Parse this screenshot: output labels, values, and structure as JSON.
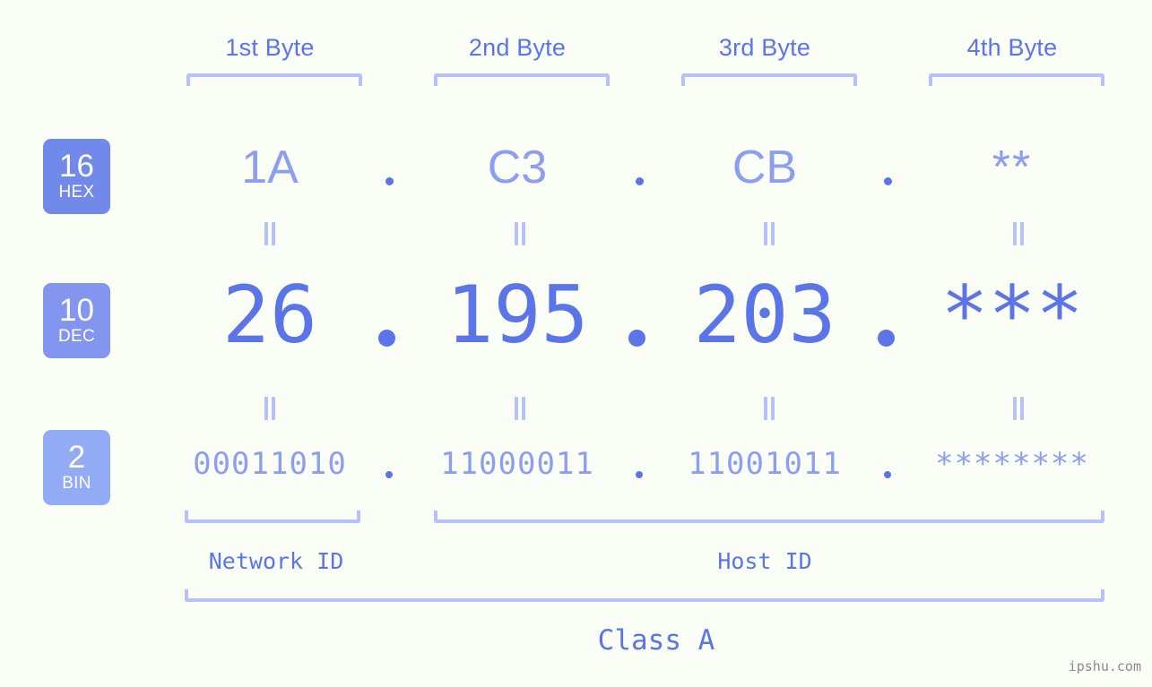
{
  "meta": {
    "background_color": "#fbfdf7",
    "accent_strong": "#5b74e8",
    "accent_light": "#8d9df4",
    "accent_bracket": "#b6c0fb",
    "watermark": "ipshu.com"
  },
  "byte_headers": [
    {
      "label": "1st Byte"
    },
    {
      "label": "2nd Byte"
    },
    {
      "label": "3rd Byte"
    },
    {
      "label": "4th Byte"
    }
  ],
  "bases": [
    {
      "num": "16",
      "name": "HEX",
      "color": "#7289ec"
    },
    {
      "num": "10",
      "name": "DEC",
      "color": "#8495f0"
    },
    {
      "num": "2",
      "name": "BIN",
      "color": "#93aaf5"
    }
  ],
  "rows": {
    "hex": {
      "values": [
        "1A",
        "C3",
        "CB",
        "**"
      ],
      "separator": "."
    },
    "dec": {
      "values": [
        "26",
        "195",
        "203",
        "***"
      ],
      "separator": "."
    },
    "bin": {
      "values": [
        "00011010",
        "11000011",
        "11001011",
        "********"
      ],
      "separator": "."
    }
  },
  "segments": {
    "network_id": "Network ID",
    "host_id": "Host ID",
    "class": "Class A"
  }
}
